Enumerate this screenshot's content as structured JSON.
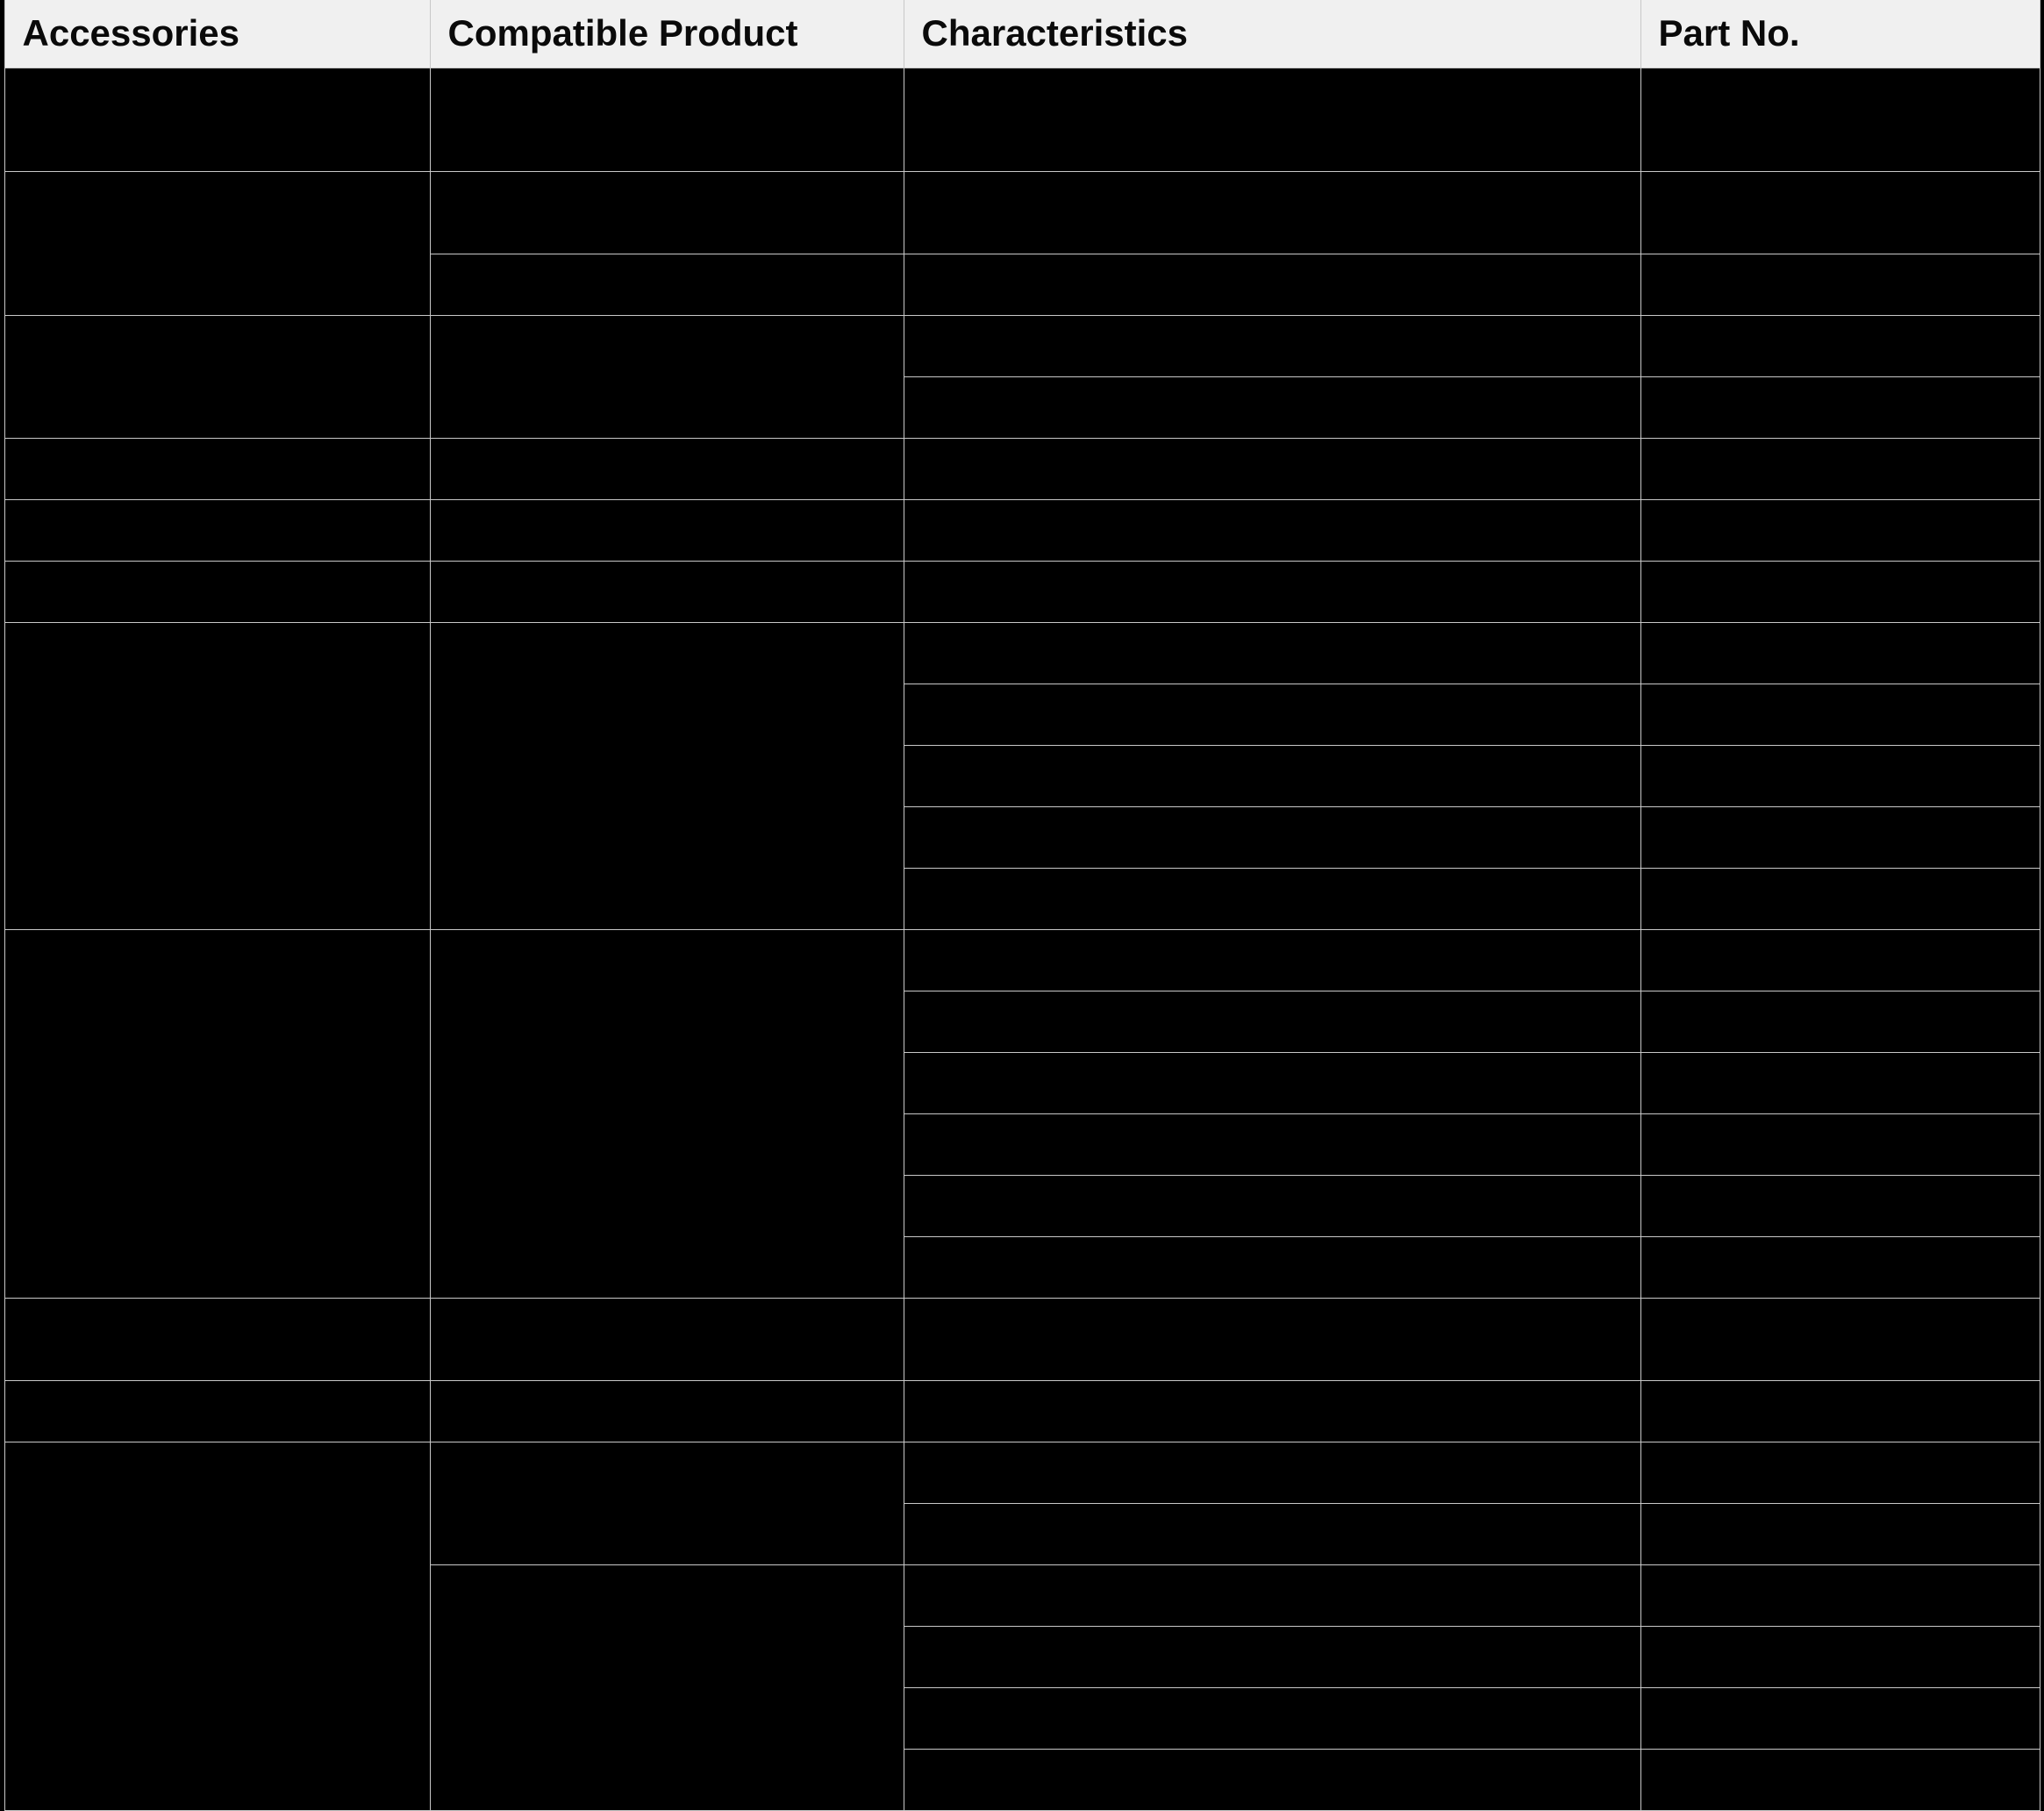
{
  "headers": {
    "c1": "Accessories",
    "c2": "Compatible Product",
    "c3": "Characteristics",
    "c4": "Part No."
  },
  "rows": [
    {
      "h": "big",
      "c1": "",
      "c2": "",
      "c3": "",
      "c4": ""
    },
    {
      "h": "med",
      "c1": "",
      "c1_rowspan": 2,
      "c2": "",
      "c3": "",
      "c4": ""
    },
    {
      "h": "std",
      "c2": "",
      "c3": "",
      "c4": ""
    },
    {
      "h": "std",
      "c1": "",
      "c1_rowspan": 2,
      "c2": "",
      "c2_rowspan": 2,
      "c3": "",
      "c4": ""
    },
    {
      "h": "std",
      "c3": "",
      "c4": ""
    },
    {
      "h": "std",
      "c1": "",
      "c2": "",
      "c3": "",
      "c4": ""
    },
    {
      "h": "std",
      "c1": "",
      "c2": "",
      "c3": "",
      "c4": ""
    },
    {
      "h": "std",
      "c1": "",
      "c2": "",
      "c3": "",
      "c4": ""
    },
    {
      "h": "std",
      "c1": "",
      "c1_rowspan": 5,
      "c2": "",
      "c2_rowspan": 5,
      "c3": "",
      "c4": ""
    },
    {
      "h": "std",
      "c3": "",
      "c4": ""
    },
    {
      "h": "std",
      "c3": "",
      "c4": ""
    },
    {
      "h": "std",
      "c3": "",
      "c4": ""
    },
    {
      "h": "std",
      "c3": "",
      "c4": ""
    },
    {
      "h": "std",
      "c1": "",
      "c1_rowspan": 6,
      "c2": "",
      "c2_rowspan": 6,
      "c3": "",
      "c4": ""
    },
    {
      "h": "std",
      "c3": "",
      "c4": ""
    },
    {
      "h": "std",
      "c3": "",
      "c4": ""
    },
    {
      "h": "std",
      "c3": "",
      "c4": ""
    },
    {
      "h": "std",
      "c3": "",
      "c4": ""
    },
    {
      "h": "std",
      "c3": "",
      "c4": ""
    },
    {
      "h": "med",
      "c1": "",
      "c2": "",
      "c3": "",
      "c4": ""
    },
    {
      "h": "std",
      "c1": "",
      "c2": "",
      "c3": "",
      "c4": ""
    },
    {
      "h": "std",
      "c1": "",
      "c1_rowspan": 6,
      "c2": "",
      "c2_rowspan": 2,
      "c3": "",
      "c4": ""
    },
    {
      "h": "std",
      "c3": "",
      "c4": ""
    },
    {
      "h": "std",
      "c2": "",
      "c2_rowspan": 4,
      "c3": "",
      "c4": ""
    },
    {
      "h": "std",
      "c3": "",
      "c4": ""
    },
    {
      "h": "std",
      "c3": "",
      "c4": ""
    },
    {
      "h": "std",
      "c3": "",
      "c4": ""
    }
  ]
}
